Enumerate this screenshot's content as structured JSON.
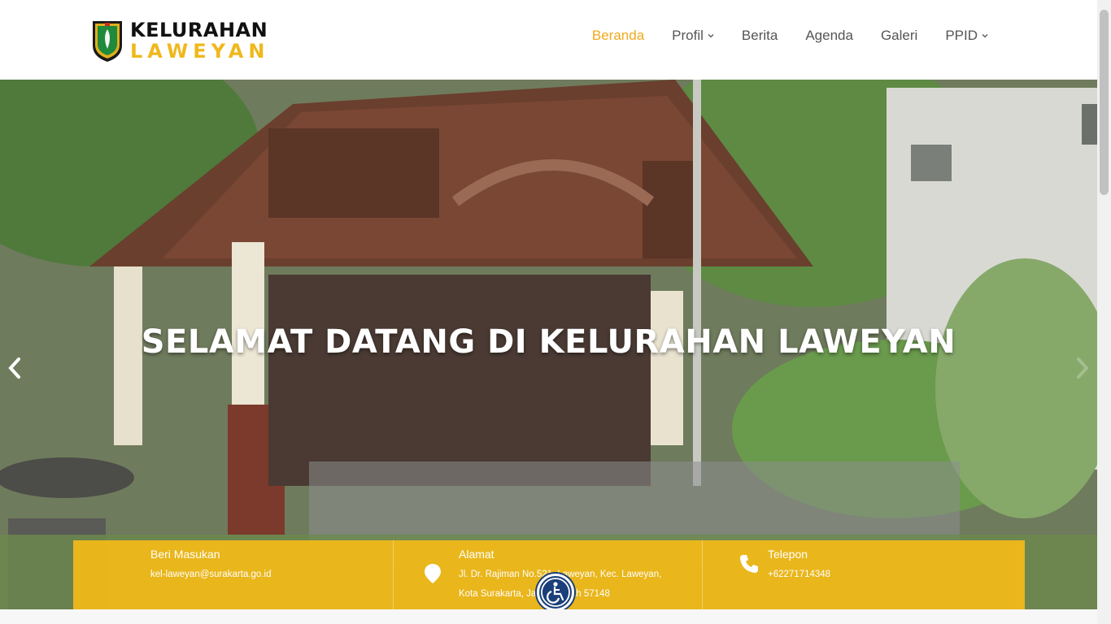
{
  "brand": {
    "line1": "KELURAHAN",
    "line2": "LAWEYAN",
    "logo_icon": "city-crest-icon"
  },
  "nav": {
    "items": [
      {
        "label": "Beranda",
        "active": true
      },
      {
        "label": "Profil",
        "dropdown": true
      },
      {
        "label": "Berita"
      },
      {
        "label": "Agenda"
      },
      {
        "label": "Galeri"
      },
      {
        "label": "PPID",
        "dropdown": true
      }
    ]
  },
  "hero": {
    "title": "SELAMAT DATANG DI KELURAHAN LAWEYAN",
    "prev_icon": "chevron-left-icon",
    "next_icon": "chevron-right-icon"
  },
  "info": {
    "feedback": {
      "title": "Beri Masukan",
      "email": "kel-laweyan@surakarta.go.id"
    },
    "address": {
      "title": "Alamat",
      "line1": "Jl. Dr. Rajiman No.521, Laweyan, Kec. Laweyan,",
      "line2": "Kota Surakarta, Jawa Tengah 57148",
      "icon": "map-pin-icon"
    },
    "phone": {
      "title": "Telepon",
      "number": "+62271714348",
      "icon": "phone-icon"
    }
  },
  "accessibility": {
    "icon": "wheelchair-accessibility-icon"
  },
  "colors": {
    "accent": "#f0b81d",
    "nav_active": "#f0a91a",
    "info_bar": "#f2ba18",
    "access_button": "#1a3f7a"
  }
}
